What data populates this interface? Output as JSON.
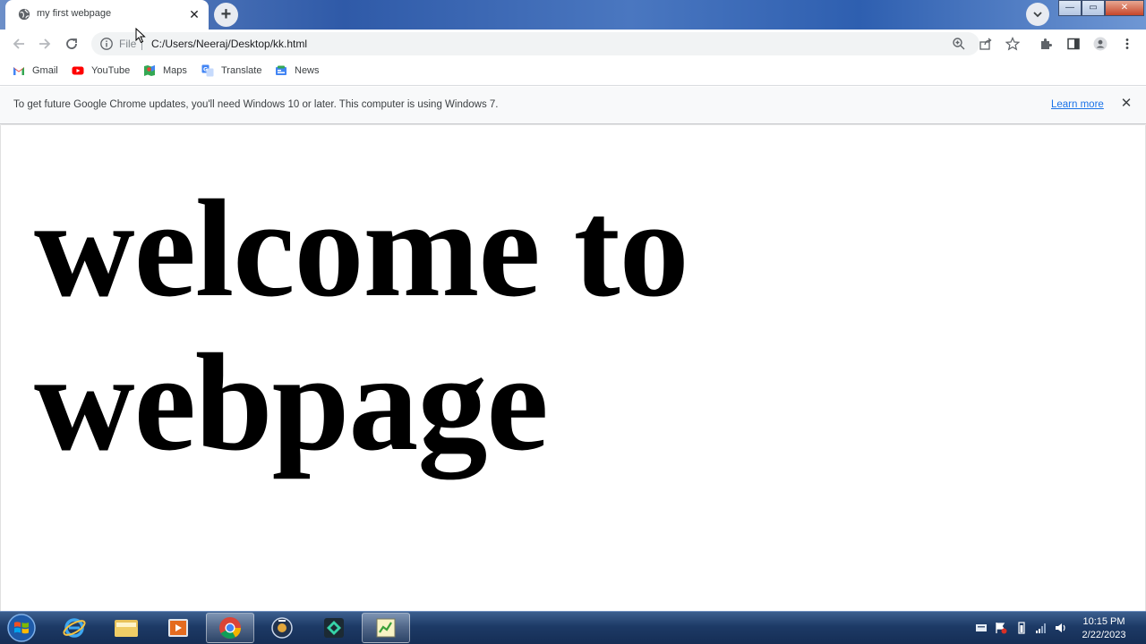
{
  "browser": {
    "tab": {
      "title": "my first webpage",
      "close_glyph": "✕"
    },
    "new_tab_glyph": "+",
    "window_buttons": {
      "minimize": "—",
      "maximize": "▭",
      "close": "✕"
    },
    "address_bar": {
      "scheme_label": "File",
      "url": "C:/Users/Neeraj/Desktop/kk.html"
    },
    "bookmarks": [
      {
        "label": "Gmail",
        "icon": "gmail-icon"
      },
      {
        "label": "YouTube",
        "icon": "youtube-icon"
      },
      {
        "label": "Maps",
        "icon": "maps-icon"
      },
      {
        "label": "Translate",
        "icon": "translate-icon"
      },
      {
        "label": "News",
        "icon": "news-icon"
      }
    ],
    "infobar": {
      "message": "To get future Google Chrome updates, you'll need Windows 10 or later. This computer is using Windows 7.",
      "link": "Learn more",
      "close_glyph": "✕"
    }
  },
  "page": {
    "heading": "welcome to webpage"
  },
  "taskbar": {
    "time": "10:15 PM",
    "date": "2/22/2023"
  },
  "colors": {
    "link": "#1a73e8",
    "tab_bg": "#ffffff",
    "infobar_bg": "#f8f9fa",
    "taskbar": "#1d3a66"
  }
}
